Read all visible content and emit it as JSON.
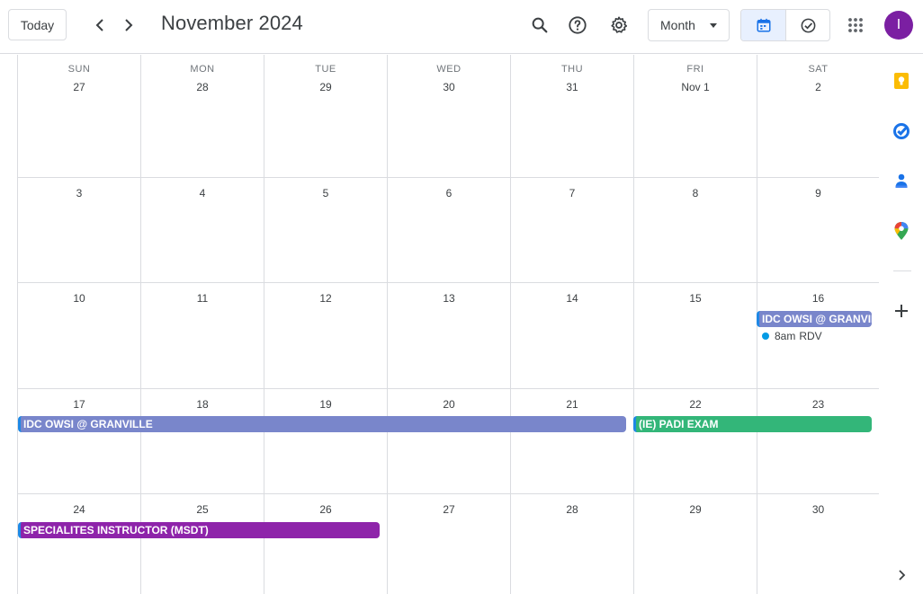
{
  "header": {
    "today_label": "Today",
    "title": "November 2024",
    "view_label": "Month",
    "avatar_initial": "I",
    "colors": {
      "accent": "#1a73e8",
      "avatar": "#7b1fa2"
    }
  },
  "weekdays": [
    "SUN",
    "MON",
    "TUE",
    "WED",
    "THU",
    "FRI",
    "SAT"
  ],
  "weeks": [
    [
      "27",
      "28",
      "29",
      "30",
      "31",
      "Nov 1",
      "2"
    ],
    [
      "3",
      "4",
      "5",
      "6",
      "7",
      "8",
      "9"
    ],
    [
      "10",
      "11",
      "12",
      "13",
      "14",
      "15",
      "16"
    ],
    [
      "17",
      "18",
      "19",
      "20",
      "21",
      "22",
      "23"
    ],
    [
      "24",
      "25",
      "26",
      "27",
      "28",
      "29",
      "30"
    ]
  ],
  "events": {
    "idc_week3": {
      "title": "IDC OWSI @ GRANVIL",
      "color": "#7986cb"
    },
    "rdv": {
      "time": "8am",
      "title": "RDV",
      "dot_color": "#039be5"
    },
    "idc_week4": {
      "title": "IDC OWSI @ GRANVILLE",
      "color": "#7986cb"
    },
    "padi": {
      "title": "(IE) PADI EXAM",
      "color": "#33b679"
    },
    "msdt": {
      "title": "SPECIALITES INSTRUCTOR (MSDT)",
      "color": "#8e24aa"
    }
  },
  "side_panel": {
    "icons": [
      "keep-icon",
      "tasks-icon",
      "contacts-icon",
      "maps-icon",
      "add-icon",
      "expand-icon"
    ]
  }
}
